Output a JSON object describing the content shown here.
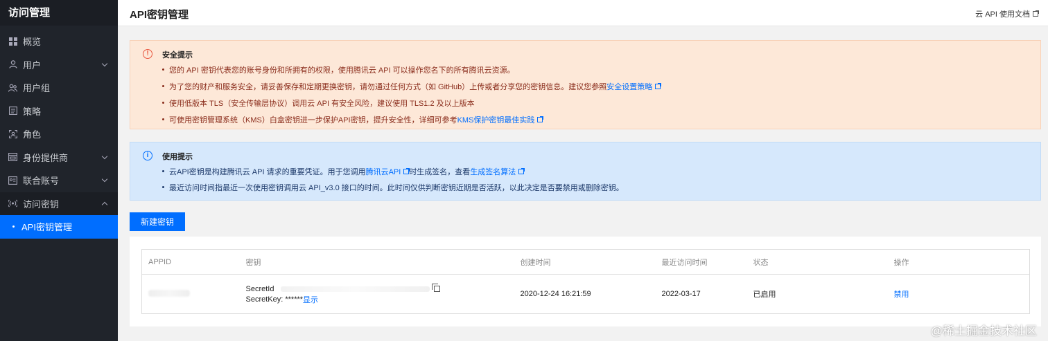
{
  "sidebar": {
    "title": "访问管理",
    "items": [
      {
        "label": "概览"
      },
      {
        "label": "用户"
      },
      {
        "label": "用户组"
      },
      {
        "label": "策略"
      },
      {
        "label": "角色"
      },
      {
        "label": "身份提供商"
      },
      {
        "label": "联合账号"
      },
      {
        "label": "访问密钥"
      },
      {
        "label": "API密钥管理"
      }
    ]
  },
  "header": {
    "title": "API密钥管理",
    "doc_link": "云 API 使用文档"
  },
  "security_alert": {
    "title": "安全提示",
    "items": [
      "您的 API 密钥代表您的账号身份和所拥有的权限，使用腾讯云 API 可以操作您名下的所有腾讯云资源。",
      "为了您的财产和服务安全，请妥善保存和定期更换密钥，请勿通过任何方式（如 GitHub）上传或者分享您的密钥信息。建议您参照",
      "使用低版本 TLS（安全传输层协议）调用云 API 有安全风险，建议使用 TLS1.2 及以上版本",
      "可使用密钥管理系统（KMS）白盒密钥进一步保护API密钥，提升安全性，详细可参考"
    ],
    "link_policy": "安全设置策略",
    "link_kms": "KMS保护密钥最佳实践"
  },
  "usage_alert": {
    "title": "使用提示",
    "item1_pre": "云API密钥是构建腾讯云 API 请求的重要凭证。用于您调用",
    "item1_link1": "腾讯云API",
    "item1_mid": "时生成签名，查看",
    "item1_link2": "生成签名算法",
    "item2": "最近访问时间指最近一次使用密钥调用云 API_v3.0 接口的时间。此时间仅供判断密钥近期是否活跃，以此决定是否要禁用或删除密钥。"
  },
  "actions": {
    "create_key": "新建密钥"
  },
  "table": {
    "columns": [
      "APPID",
      "密钥",
      "创建时间",
      "最近访问时间",
      "状态",
      "操作"
    ],
    "row": {
      "secret_id_label": "SecretId",
      "secret_key_label": "SecretKey: ******",
      "show_link": "显示",
      "created": "2020-12-24 16:21:59",
      "last_access": "2022-03-17",
      "status": "已启用",
      "action": "禁用"
    }
  },
  "watermark": "@稀土掘金技术社区",
  "colors": {
    "accent": "#006eff",
    "sidebar_bg": "#20242b",
    "warn_bg": "#fde8d8",
    "info_bg": "#d6e8fc",
    "status_ok": "#0abf5b"
  }
}
